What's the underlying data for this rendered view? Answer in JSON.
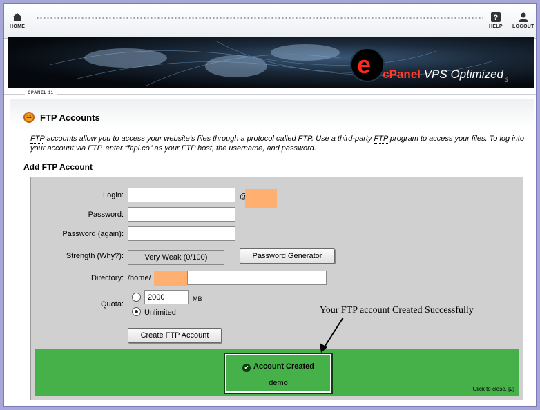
{
  "nav": {
    "home": "HOME",
    "help": "HELP",
    "logout": "LOGOUT"
  },
  "banner": {
    "brand_cp": "cPanel",
    "brand_rest": "VPS Optimized",
    "brand_ver": "3"
  },
  "breadcrumb": "CPANEL 11",
  "page": {
    "badge": "11",
    "title": "FTP Accounts",
    "description_1": "accounts allow you to access your website’s files through a protocol called FTP. Use a third-party ",
    "description_2": " program to access your files. To log into your account via ",
    "description_3": ", enter “fhpl.co” as your ",
    "description_4": " host, the username, and password.",
    "ftp_term": "FTP",
    "subheading": "Add FTP Account"
  },
  "form": {
    "login_label": "Login:",
    "at": "@",
    "password_label": "Password:",
    "password_again_label": "Password (again):",
    "strength_label": "Strength (Why?):",
    "strength_value": "Very Weak (0/100)",
    "generator_button": "Password Generator",
    "directory_label": "Directory:",
    "directory_prefix": "/home/",
    "quota_label": "Quota:",
    "quota_value": "2000",
    "quota_unit": "MB",
    "unlimited_label": "Unlimited",
    "quota_unlimited_selected": true,
    "create_button": "Create FTP Account"
  },
  "success": {
    "title": "Account Created",
    "username": "demo",
    "close_text": "Click to close. [2]",
    "color": "#46b149"
  },
  "annotation": "Your FTP account Created Successfully"
}
